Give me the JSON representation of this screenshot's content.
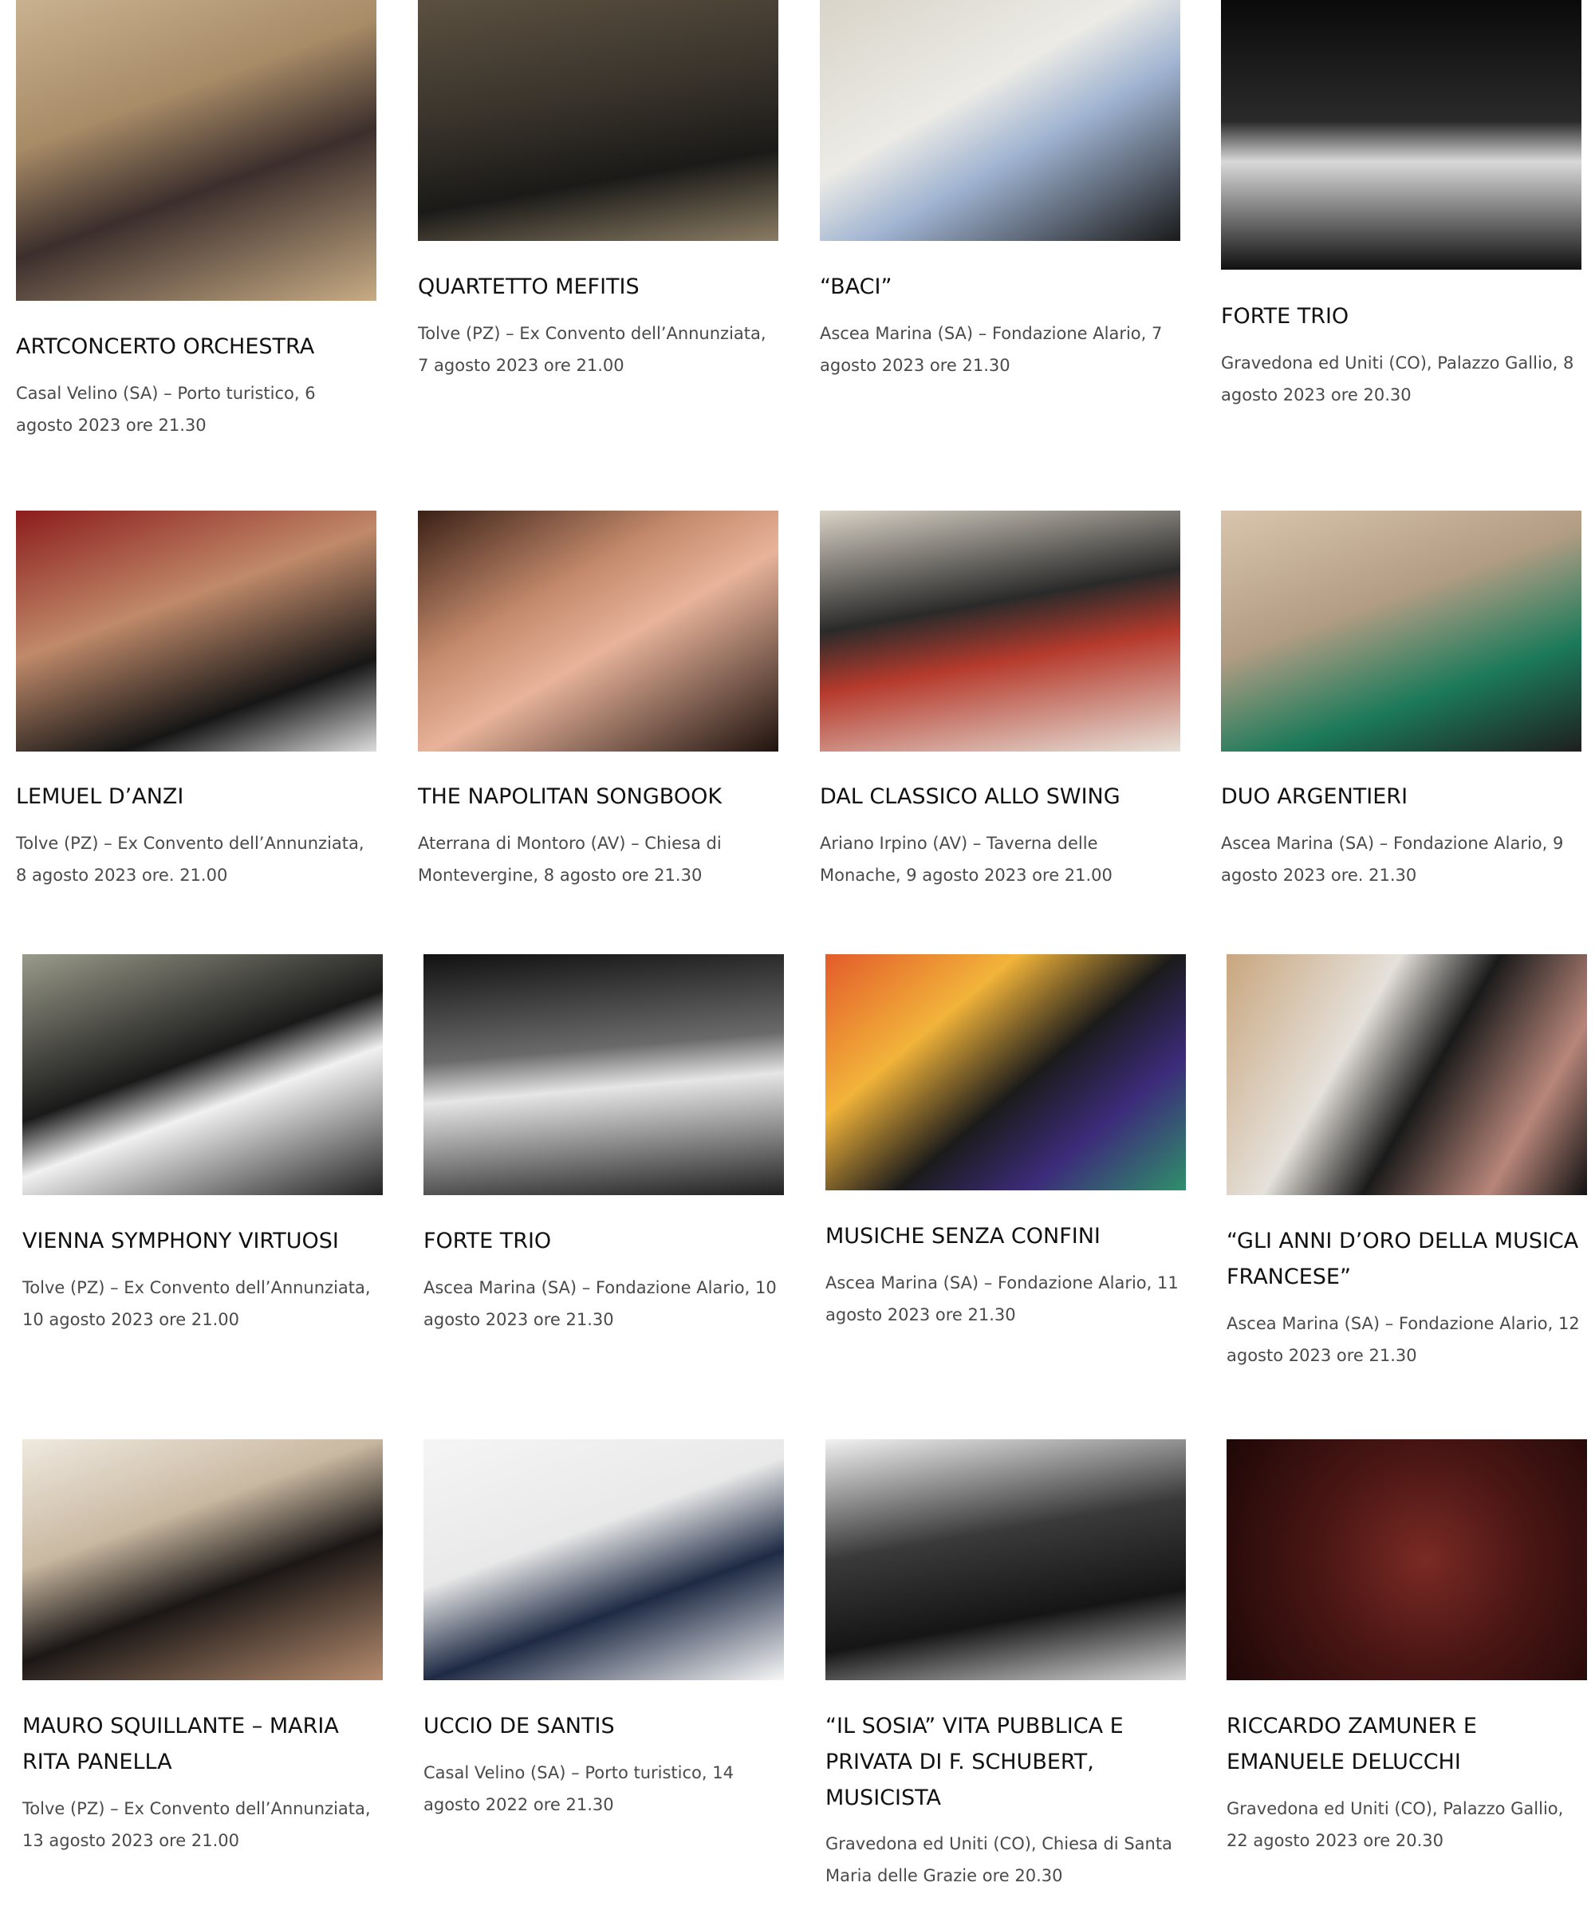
{
  "events": [
    {
      "title": "ARTCONCERTO ORCHESTRA",
      "details": "Casal Velino (SA) – Porto turistico, 6 agosto 2023 ore 21.30"
    },
    {
      "title": "QUARTETTO MEFITIS",
      "details": "Tolve (PZ) – Ex Convento dell’Annunziata, 7 agosto 2023 ore 21.00"
    },
    {
      "title": "“BACI”",
      "details": "Ascea Marina (SA) – Fondazione Alario, 7 agosto 2023 ore 21.30"
    },
    {
      "title": "FORTE TRIO",
      "details": "Gravedona ed Uniti (CO), Palazzo Gallio, 8 agosto 2023 ore 20.30"
    },
    {
      "title": "LEMUEL D’ANZI",
      "details": "Tolve (PZ) – Ex Convento dell’Annunziata, 8 agosto 2023 ore. 21.00"
    },
    {
      "title": "THE NAPOLITAN SONGBOOK",
      "details": "Aterrana di Montoro (AV) – Chiesa di Montevergine, 8 agosto ore 21.30"
    },
    {
      "title": "DAL CLASSICO ALLO SWING",
      "details": "Ariano Irpino (AV) – Taverna delle Monache, 9 agosto 2023 ore 21.00"
    },
    {
      "title": "DUO ARGENTIERI",
      "details": "Ascea Marina (SA) – Fondazione Alario, 9 agosto 2023 ore. 21.30"
    },
    {
      "title": "VIENNA SYMPHONY VIRTUOSI",
      "details": "Tolve (PZ) – Ex Convento dell’Annunziata, 10 agosto 2023 ore 21.00"
    },
    {
      "title": "FORTE TRIO",
      "details": "Ascea Marina (SA) – Fondazione Alario, 10 agosto 2023 ore 21.30"
    },
    {
      "title": "MUSICHE SENZA CONFINI",
      "details": "Ascea Marina (SA) – Fondazione Alario, 11 agosto 2023 ore 21.30"
    },
    {
      "title": "“GLI ANNI D’ORO DELLA MUSICA FRANCESE”",
      "details": "Ascea Marina (SA) – Fondazione Alario, 12 agosto 2023 ore 21.30"
    },
    {
      "title": "MAURO SQUILLANTE – MARIA RITA PANELLA",
      "details": "Tolve (PZ) – Ex Convento dell’Annunziata, 13 agosto 2023 ore 21.00"
    },
    {
      "title": "UCCIO DE SANTIS",
      "details": "Casal Velino (SA) – Porto turistico, 14 agosto 2022 ore 21.30"
    },
    {
      "title": "“IL SOSIA” VITA PUBBLICA E PRIVATA DI F. SCHUBERT, MUSICISTA",
      "details": "Gravedona ed Uniti (CO), Chiesa di Santa Maria delle Grazie ore 20.30"
    },
    {
      "title": "RICCARDO ZAMUNER E EMANUELE DELUCCHI",
      "details": "Gravedona ed Uniti (CO), Palazzo Gallio, 22 agosto 2023 ore 20.30"
    }
  ]
}
